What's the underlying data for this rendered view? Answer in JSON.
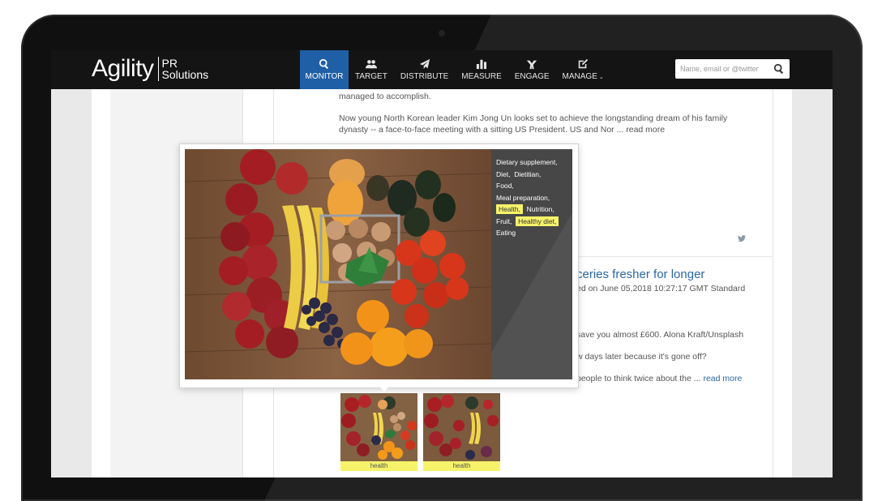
{
  "brand": {
    "name": "Agility",
    "sub_line1": "PR",
    "sub_line2": "Solutions"
  },
  "nav": [
    {
      "label": "MONITOR",
      "icon": "search-icon",
      "active": true
    },
    {
      "label": "TARGET",
      "icon": "people-icon"
    },
    {
      "label": "DISTRIBUTE",
      "icon": "paper-plane-icon"
    },
    {
      "label": "MEASURE",
      "icon": "bar-chart-icon"
    },
    {
      "label": "ENGAGE",
      "icon": "engage-icon"
    },
    {
      "label": "MANAGE",
      "icon": "edit-icon",
      "has_dropdown": true
    }
  ],
  "search": {
    "placeholder": "Name, email or @twitter"
  },
  "article1": {
    "line0": "managed to accomplish.",
    "line1": "Now young North Korean leader Kim Jong Un looks set to achieve the longstanding dream of his family",
    "line2": "dynasty -- a face-to-face meeting with a sitting US President. US and Nor ...",
    "read_more": "read more"
  },
  "article2": {
    "title": "ceries fresher for longer",
    "meta": "ed on June 05,2018 10:27:17 GMT Standard",
    "line1": "save you almost £600. Alona Kraft/Unsplash",
    "line2": "w days later because it's gone off?",
    "line3": "people to think twice about the ...",
    "read_more": "read more"
  },
  "thumbnails": [
    {
      "tag": "health"
    },
    {
      "tag": "health"
    }
  ],
  "popover": {
    "tags": [
      {
        "text": "Dietary supplement,",
        "highlight": false
      },
      {
        "text": "Diet,",
        "highlight": false
      },
      {
        "text": "Dietitian,",
        "highlight": false
      },
      {
        "text": "Food,",
        "highlight": false
      },
      {
        "text": "Meal preparation,",
        "highlight": false
      },
      {
        "text": "Health,",
        "highlight": true
      },
      {
        "text": "Nutrition,",
        "highlight": false
      },
      {
        "text": "Fruit,",
        "highlight": false
      },
      {
        "text": "Healthy diet,",
        "highlight": true
      },
      {
        "text": "Eating",
        "highlight": false
      }
    ]
  },
  "colors": {
    "header": "#141414",
    "active_nav": "#1f5fa6",
    "link": "#2a66a6",
    "tag_highlight": "#f6f36a"
  }
}
